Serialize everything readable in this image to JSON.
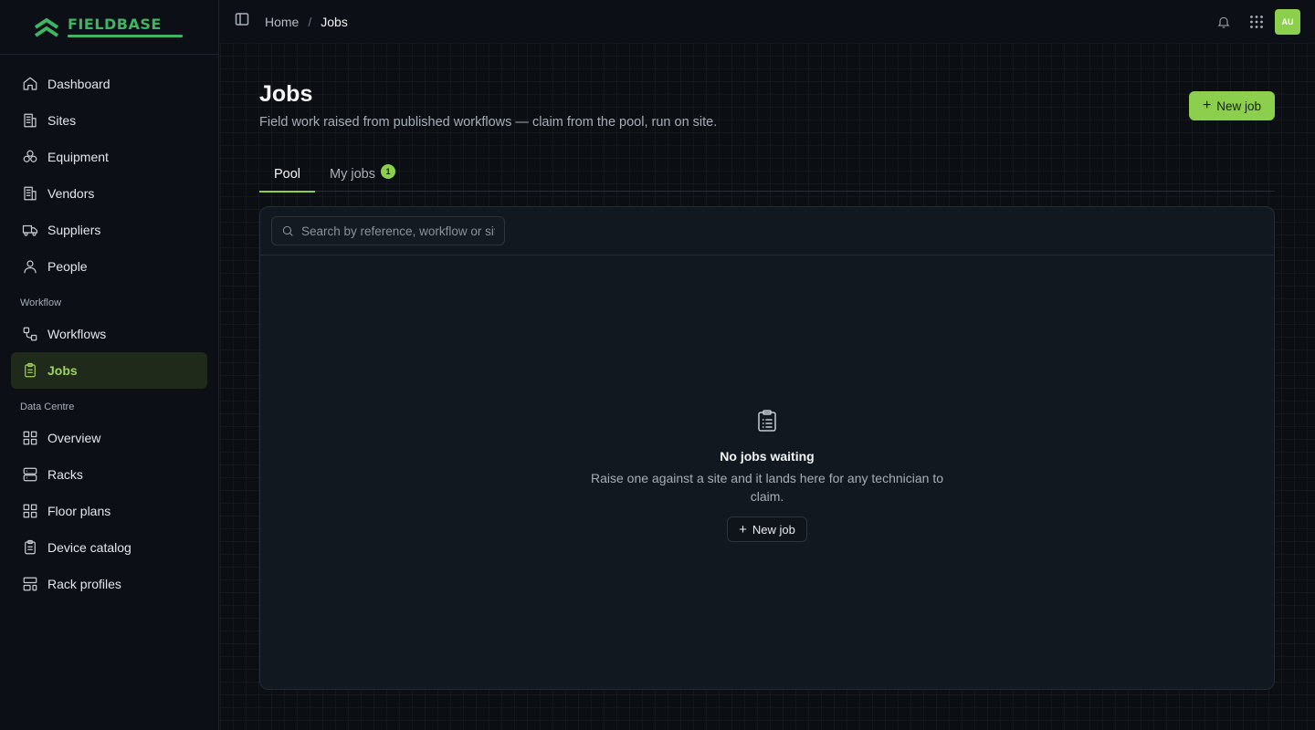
{
  "brand": {
    "name": "FIELDBASE",
    "color": "#3fb462",
    "accent": "#8ccf4d"
  },
  "sidebar": {
    "items": [
      {
        "label": "Dashboard",
        "icon": "home-icon"
      },
      {
        "label": "Sites",
        "icon": "building-icon"
      },
      {
        "label": "Equipment",
        "icon": "boxes-icon"
      },
      {
        "label": "Vendors",
        "icon": "building-icon"
      },
      {
        "label": "Suppliers",
        "icon": "truck-icon"
      },
      {
        "label": "People",
        "icon": "user-icon"
      }
    ],
    "workflow_section": {
      "title": "Workflow",
      "items": [
        {
          "label": "Workflows",
          "icon": "workflow-icon"
        },
        {
          "label": "Jobs",
          "icon": "clipboard-icon",
          "active": true
        }
      ]
    },
    "datacentre_section": {
      "title": "Data Centre",
      "items": [
        {
          "label": "Overview",
          "icon": "layout-grid-icon"
        },
        {
          "label": "Racks",
          "icon": "server-icon"
        },
        {
          "label": "Floor plans",
          "icon": "layout-grid-icon"
        },
        {
          "label": "Device catalog",
          "icon": "clipboard-list-icon"
        },
        {
          "label": "Rack profiles",
          "icon": "layout-template-icon"
        }
      ]
    }
  },
  "topbar": {
    "breadcrumb": {
      "home": "Home",
      "separator": "/",
      "current": "Jobs"
    },
    "avatar_initials": "AU"
  },
  "page": {
    "title": "Jobs",
    "subtitle": "Field work raised from published workflows — claim from the pool, run on site.",
    "new_job_label": "New job"
  },
  "tabs": [
    {
      "label": "Pool",
      "active": true
    },
    {
      "label": "My jobs",
      "badge": "1"
    }
  ],
  "search": {
    "placeholder": "Search by reference, workflow or site",
    "value": ""
  },
  "empty_state": {
    "title": "No jobs waiting",
    "text": "Raise one against a site and it lands here for any technician to claim.",
    "button_label": "New job"
  }
}
